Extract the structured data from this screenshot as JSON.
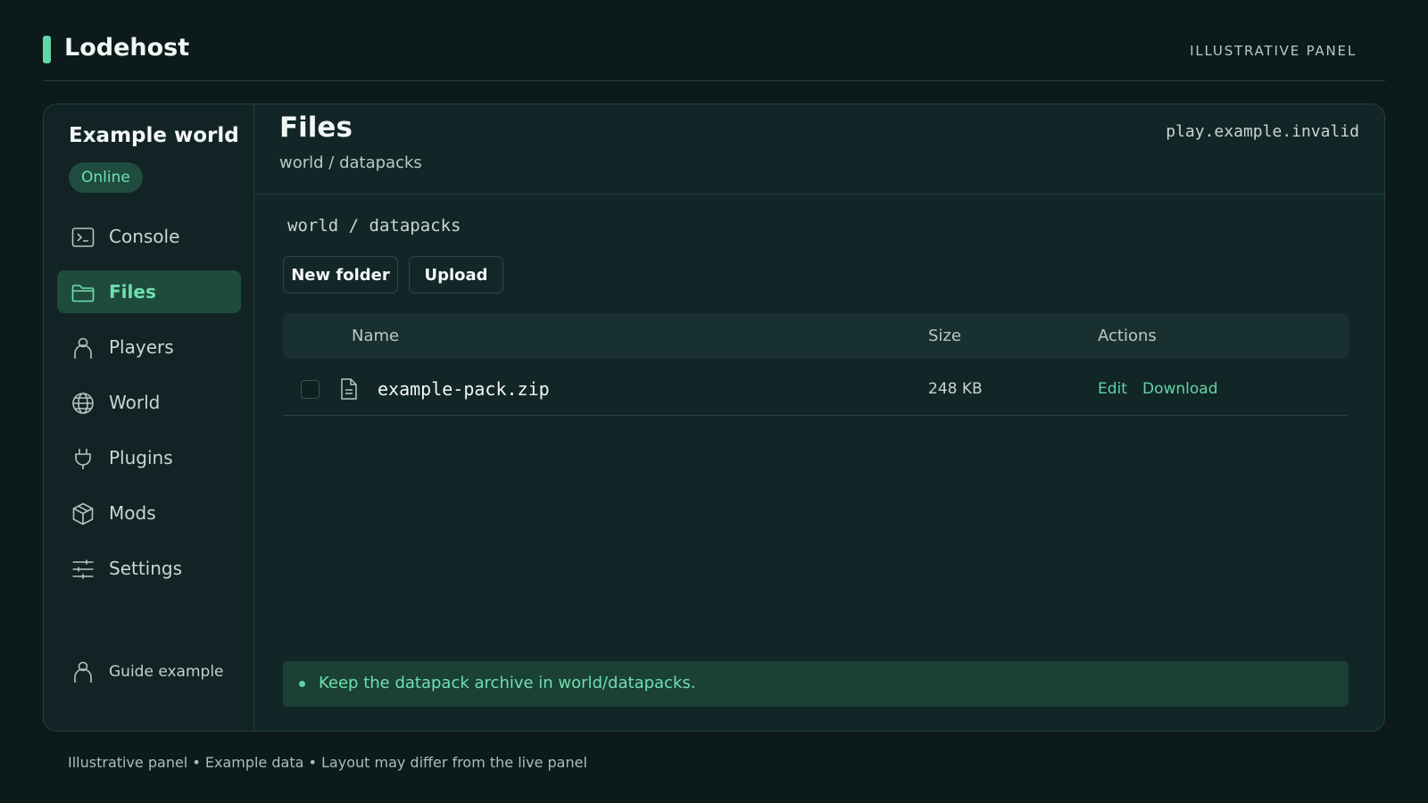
{
  "app": {
    "brand": "Lodehost",
    "top_label": "ILLUSTRATIVE PANEL",
    "accent_color": "#5fd8a6"
  },
  "sidebar": {
    "server_name": "Example world",
    "status": "Online",
    "items": [
      {
        "label": "Console",
        "icon": "terminal-icon"
      },
      {
        "label": "Files",
        "icon": "folder-icon",
        "active": true
      },
      {
        "label": "Players",
        "icon": "person-icon"
      },
      {
        "label": "World",
        "icon": "globe-icon"
      },
      {
        "label": "Plugins",
        "icon": "plug-icon"
      },
      {
        "label": "Mods",
        "icon": "cube-icon"
      },
      {
        "label": "Settings",
        "icon": "sliders-icon"
      }
    ],
    "user": {
      "label": "Guide example",
      "icon": "person-icon"
    }
  },
  "header": {
    "title": "Files",
    "subtitle": "world / datapacks",
    "address": "play.example.invalid"
  },
  "files": {
    "path": "world / datapacks",
    "new_folder_label": "New folder",
    "upload_label": "Upload",
    "columns": {
      "name": "Name",
      "size": "Size",
      "actions": "Actions"
    },
    "rows": [
      {
        "name": "example-pack.zip",
        "size": "248 KB",
        "icon": "file-icon",
        "checked": false,
        "actions": {
          "edit": "Edit",
          "download": "Download"
        }
      }
    ],
    "hint": "Keep the datapack archive in world/datapacks."
  },
  "footer": "Illustrative panel • Example data • Layout may differ from the live panel"
}
